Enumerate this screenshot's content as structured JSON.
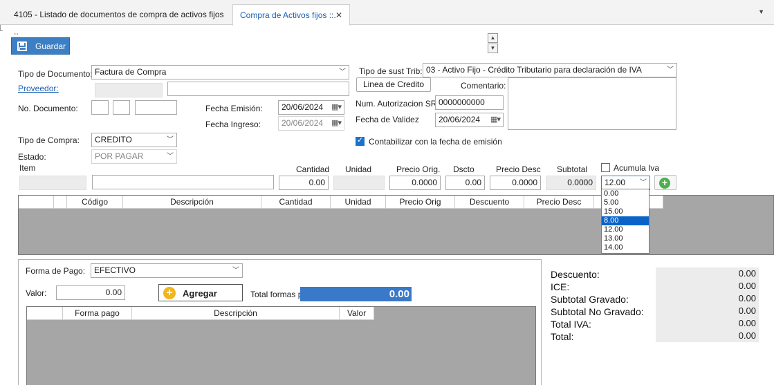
{
  "tabs": [
    {
      "label": "4105 - Listado de documentos de compra de activos fijos ::."
    },
    {
      "label": "Compra de Activos fijos ::."
    }
  ],
  "toolbar": {
    "save_label": "Guardar"
  },
  "form": {
    "tipo_documento_label": "Tipo de Documento:",
    "tipo_documento_value": "Factura de Compra",
    "proveedor_label": "Proveedor:",
    "no_documento_label": "No. Documento:",
    "fecha_emision_label": "Fecha Emisión:",
    "fecha_emision_value": "20/06/2024",
    "fecha_ingreso_label": "Fecha Ingreso:",
    "fecha_ingreso_value": "20/06/2024",
    "tipo_compra_label": "Tipo de Compra:",
    "tipo_compra_value": "CREDITO",
    "estado_label": "Estado:",
    "estado_value": "POR PAGAR",
    "tipo_sust_label": "Tipo de sust Trib:",
    "tipo_sust_value": "03 - Activo Fijo - Crédito Tributario para declaración de IVA",
    "linea_credito_label": "Linea de Credito",
    "comentario_label": "Comentario:",
    "num_aut_label": "Num. Autorizacion SRI",
    "num_aut_value": "0000000000",
    "fecha_validez_label": "Fecha de Validez",
    "fecha_validez_value": "20/06/2024",
    "contabilizar_label": "Contabilizar con la fecha de emisión"
  },
  "item": {
    "item_label": "Item",
    "cantidad_label": "Cantidad",
    "cantidad_value": "0.00",
    "unidad_label": "Unidad",
    "precio_orig_label": "Precio Orig.",
    "precio_orig_value": "0.0000",
    "dscto_label": "Dscto",
    "dscto_value": "0.00",
    "precio_desc_label": "Precio Desc",
    "precio_desc_value": "0.0000",
    "subtotal_label": "Subtotal",
    "subtotal_value": "0.0000",
    "acumula_iva_label": "Acumula Iva",
    "iva_selected": "12.00",
    "iva_options": [
      "0.00",
      "5.00",
      "15.00",
      "8.00",
      "12.00",
      "13.00",
      "14.00"
    ]
  },
  "items_grid": {
    "columns": [
      "",
      "",
      "Código",
      "Descripción",
      "Cantidad",
      "Unidad",
      "Precio Orig",
      "Descuento",
      "Precio Desc"
    ]
  },
  "pago": {
    "forma_label": "Forma de Pago:",
    "forma_value": "EFECTIVO",
    "valor_label": "Valor:",
    "valor_value": "0.00",
    "agregar_label": "Agregar",
    "total_label": "Total formas pago:",
    "total_value": "0.00",
    "columns": [
      "",
      "Forma pago",
      "Descripción",
      "Valor"
    ]
  },
  "summary": [
    {
      "label": "Descuento:",
      "value": "0.00"
    },
    {
      "label": "ICE:",
      "value": "0.00"
    },
    {
      "label": "Subtotal Gravado:",
      "value": "0.00"
    },
    {
      "label": "Subtotal No Gravado:",
      "value": "0.00"
    },
    {
      "label": "Total IVA:",
      "value": "0.00"
    },
    {
      "label": "Total:",
      "value": "0.00"
    }
  ]
}
